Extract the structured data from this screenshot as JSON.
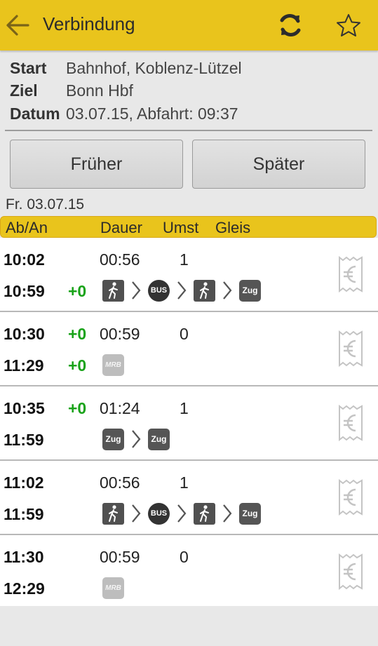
{
  "header": {
    "title": "Verbindung",
    "back_icon": "arrow-left-icon",
    "refresh_icon": "refresh-icon",
    "favorite_icon": "star-outline-icon",
    "bg_color": "#e9c41c"
  },
  "info": {
    "start_label": "Start",
    "start_value": "Bahnhof, Koblenz-Lützel",
    "ziel_label": "Ziel",
    "ziel_value": "Bonn Hbf",
    "datum_label": "Datum",
    "datum_value": "03.07.15, Abfahrt: 09:37"
  },
  "buttons": {
    "earlier": "Früher",
    "later": "Später"
  },
  "list_date": "Fr. 03.07.15",
  "columns": {
    "aban": "Ab/An",
    "dauer": "Dauer",
    "umst": "Umst",
    "gleis": "Gleis"
  },
  "connections": [
    {
      "dep": "10:02",
      "dep_delay": "",
      "arr": "10:59",
      "arr_delay": "+0",
      "duration": "00:56",
      "changes": "1",
      "segments": [
        "walk",
        "BUS",
        "walk",
        "Zug"
      ]
    },
    {
      "dep": "10:30",
      "dep_delay": "+0",
      "arr": "11:29",
      "arr_delay": "+0",
      "duration": "00:59",
      "changes": "0",
      "segments": [
        "MRB"
      ]
    },
    {
      "dep": "10:35",
      "dep_delay": "+0",
      "arr": "11:59",
      "arr_delay": "",
      "duration": "01:24",
      "changes": "1",
      "segments": [
        "Zug",
        "Zug"
      ]
    },
    {
      "dep": "11:02",
      "dep_delay": "",
      "arr": "11:59",
      "arr_delay": "",
      "duration": "00:56",
      "changes": "1",
      "segments": [
        "walk",
        "BUS",
        "walk",
        "Zug"
      ]
    },
    {
      "dep": "11:30",
      "dep_delay": "",
      "arr": "12:29",
      "arr_delay": "",
      "duration": "00:59",
      "changes": "0",
      "segments": [
        "MRB"
      ]
    }
  ],
  "ticket_icon": "euro-ticket-icon",
  "colors": {
    "accent": "#e9c41c",
    "delay_ok": "#1aa31a"
  }
}
